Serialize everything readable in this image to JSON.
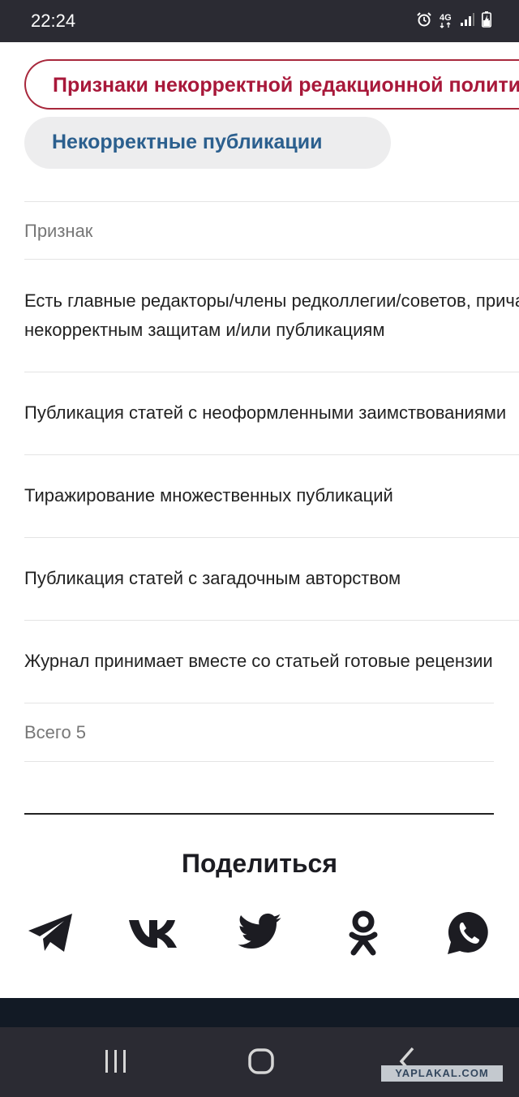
{
  "status_bar": {
    "time": "22:24",
    "network": "4G",
    "icons": [
      "alarm-icon",
      "network-4g-icon",
      "signal-icon",
      "battery-charging-icon"
    ]
  },
  "chips": {
    "active": "Признаки некорректной редакционной политики",
    "secondary": "Некорректные публикации"
  },
  "table": {
    "header": "Признак",
    "rows": [
      "Есть главные редакторы/члены редколлегии/советов, причастные к некорректным защитам и/или публикациям",
      "Публикация статей с неоформленными заимствованиями",
      "Тиражирование множественных публикаций",
      "Публикация статей с загадочным авторством",
      "Журнал принимает вместе со статьей готовые рецензии"
    ],
    "row1_line1": "Есть главные редакторы/члены редколлегии/советов, причастные к",
    "row1_line2": "некорректным защитам и/или публикациям",
    "total": "Всего 5"
  },
  "share": {
    "title": "Поделиться",
    "icons": [
      "telegram-icon",
      "vk-icon",
      "twitter-icon",
      "odnoklassniki-icon",
      "whatsapp-icon"
    ]
  },
  "navigation": {
    "icons": [
      "recent-apps-icon",
      "home-icon",
      "back-icon"
    ]
  },
  "watermark": "YAPLAKAL.COM",
  "colors": {
    "active_chip_border": "#a8283c",
    "active_chip_text": "#a8183a",
    "secondary_chip_text": "#2b5f8e",
    "secondary_chip_bg": "#ededee",
    "status_bar": "#2b2b33",
    "share_icons": "#1c1c22"
  }
}
